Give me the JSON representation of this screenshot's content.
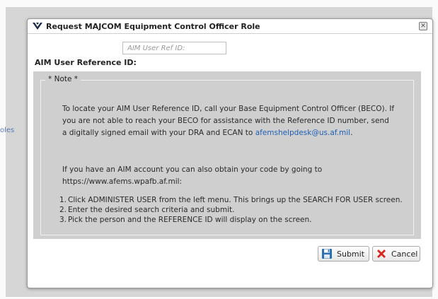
{
  "background": {
    "side_text": "oles"
  },
  "dialog": {
    "title": "Request MAJCOM Equipment Control Officer Role",
    "close_glyph": "✕",
    "reference": {
      "placeholder": "AIM User Ref ID:",
      "value": "",
      "label": "AIM User Reference ID:"
    },
    "note": {
      "heading": "* Note *",
      "paragraph1": "To locate your AIM User Reference ID, call your Base Equipment Control Officer (BECO). If you are not able to reach your BECO for assistance with the Reference ID number, send a digitally signed email with your DRA and ECAN to ",
      "email": "afemshelpdesk@us.af.mil",
      "paragraph1_end": ".",
      "paragraph2": "If you have an AIM account you can also obtain your code by going to https://www.afems.wpafb.af.mil:",
      "steps": [
        {
          "num": "1.",
          "text": "Click ADMINISTER USER from the left menu. This brings up the SEARCH FOR USER screen."
        },
        {
          "num": "2.",
          "text": "Enter the desired search criteria and submit."
        },
        {
          "num": "3.",
          "text": "Pick the person and the REFERENCE ID will display on the screen."
        }
      ]
    },
    "buttons": {
      "submit": "Submit",
      "cancel": "Cancel"
    }
  },
  "icons": {
    "title": "usaf-wings-icon",
    "submit": "save-disk-icon",
    "cancel": "red-x-icon"
  },
  "colors": {
    "link": "#1e5fb5",
    "submit_icon": "#2c6fb3",
    "cancel_icon": "#d8261c"
  }
}
